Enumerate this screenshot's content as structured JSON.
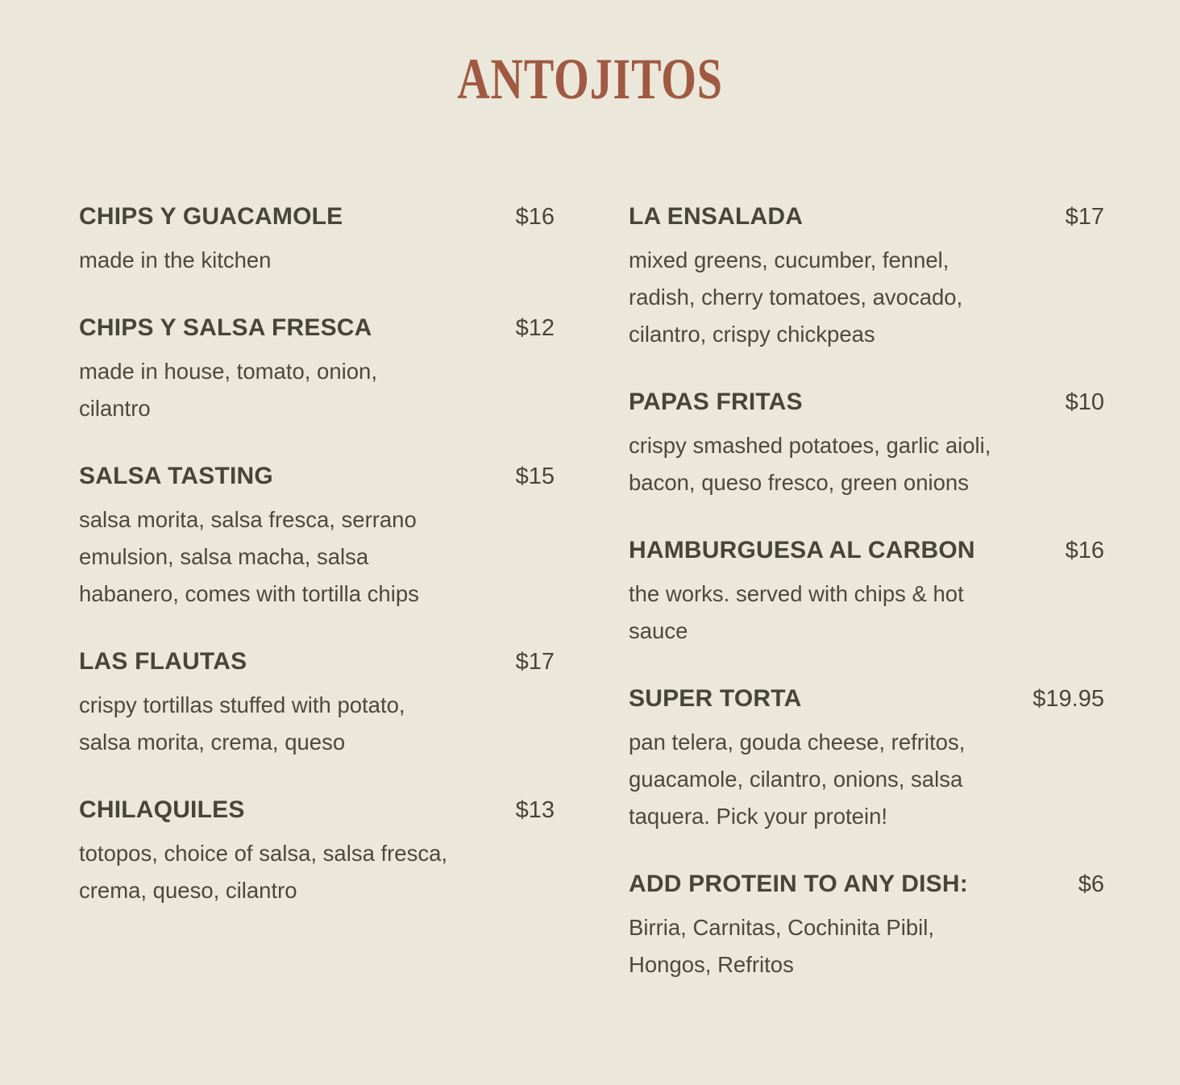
{
  "title": "ANTOJITOS",
  "left_items": [
    {
      "name": "CHIPS Y GUACAMOLE",
      "price": "$16",
      "desc": "made in the kitchen"
    },
    {
      "name": "CHIPS Y SALSA FRESCA",
      "price": "$12",
      "desc": "made in house, tomato, onion, cilantro"
    },
    {
      "name": "SALSA TASTING",
      "price": "$15",
      "desc": "salsa morita, salsa fresca, serrano emulsion, salsa macha, salsa habanero, comes with tortilla chips"
    },
    {
      "name": "LAS FLAUTAS",
      "price": "$17",
      "desc": "crispy tortillas stuffed with potato, salsa morita, crema, queso"
    },
    {
      "name": "CHILAQUILES",
      "price": "$13",
      "desc": "totopos, choice of salsa, salsa fresca, crema, queso, cilantro"
    }
  ],
  "right_items": [
    {
      "name": "LA ENSALADA",
      "price": "$17",
      "desc": "mixed greens, cucumber, fennel, radish, cherry tomatoes, avocado, cilantro, crispy chickpeas"
    },
    {
      "name": "PAPAS FRITAS",
      "price": "$10",
      "desc": "crispy smashed potatoes, garlic aioli, bacon, queso fresco, green onions"
    },
    {
      "name": "HAMBURGUESA AL CARBON",
      "price": "$16",
      "desc": "the works. served with chips & hot sauce"
    },
    {
      "name": "SUPER TORTA",
      "price": "$19.95",
      "desc": "pan telera, gouda cheese, refritos, guacamole, cilantro, onions, salsa taquera. Pick your protein!"
    },
    {
      "name": "ADD PROTEIN TO ANY DISH:",
      "price": "$6",
      "desc": "Birria, Carnitas, Cochinita Pibil, Hongos, Refritos"
    }
  ],
  "colors": {
    "background": "#ebe7da",
    "title": "#a05a42",
    "text": "#464638"
  }
}
